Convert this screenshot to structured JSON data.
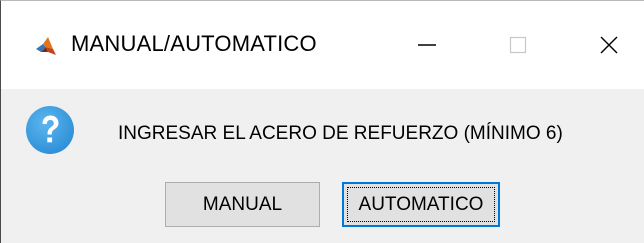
{
  "window": {
    "title": "MANUAL/AUTOMATICO",
    "app_icon": "matlab-icon",
    "controls": {
      "minimize_icon": "minimize-icon",
      "maximize_icon": "maximize-icon",
      "close_icon": "close-icon"
    }
  },
  "dialog": {
    "icon": "question-icon",
    "message": "INGRESAR EL ACERO DE REFUERZO (MÍNIMO 6)",
    "buttons": {
      "manual_label": "MANUAL",
      "automatic_label": "AUTOMATICO",
      "focused": "AUTOMATICO"
    }
  },
  "colors": {
    "titlebar_bg": "#ffffff",
    "dialog_bg": "#f0f0f0",
    "button_bg": "#e1e1e1",
    "focus_border": "#0078d7",
    "question_icon": "#3a9ad9"
  }
}
